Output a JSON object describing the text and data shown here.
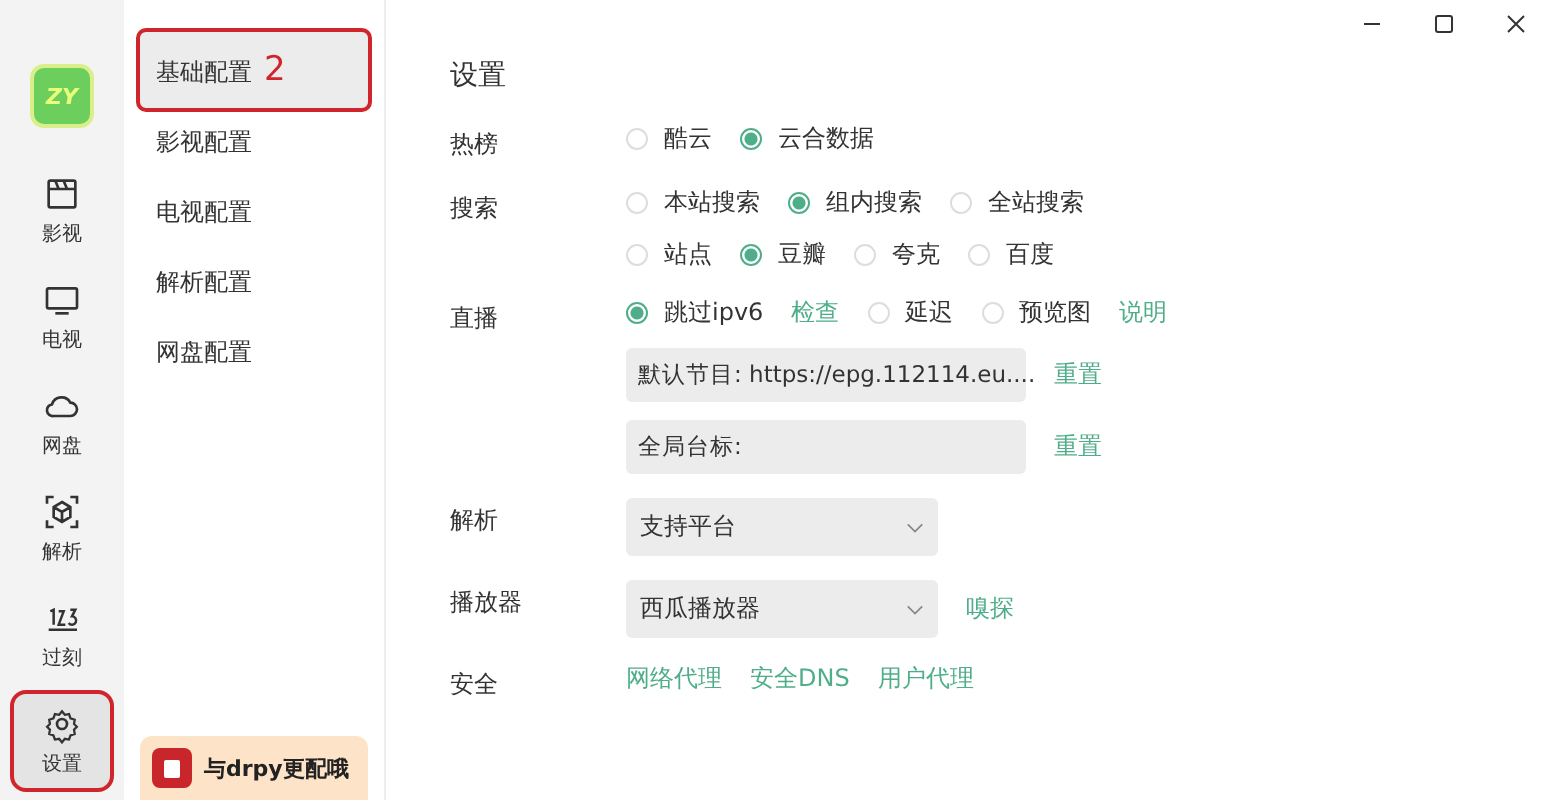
{
  "rail": [
    {
      "label": "影视",
      "kind": "film",
      "selected": false
    },
    {
      "label": "电视",
      "kind": "tv",
      "selected": false
    },
    {
      "label": "网盘",
      "kind": "cloud",
      "selected": false
    },
    {
      "label": "解析",
      "kind": "cube",
      "selected": false
    },
    {
      "label": "过刻",
      "kind": "numbers",
      "selected": false
    },
    {
      "label": "设置",
      "kind": "gear",
      "selected": true
    }
  ],
  "logo": "ZY",
  "submenu": [
    {
      "label": "基础配置",
      "selected": true
    },
    {
      "label": "影视配置",
      "selected": false
    },
    {
      "label": "电视配置",
      "selected": false
    },
    {
      "label": "解析配置",
      "selected": false
    },
    {
      "label": "网盘配置",
      "selected": false
    }
  ],
  "annotation_number": "2",
  "promo": "与drpy更配哦",
  "page_title": "设置",
  "sections": [
    {
      "label": "热榜",
      "kind": "radios",
      "lines": [
        [
          {
            "label": "酷云",
            "selected": false
          },
          {
            "label": "云合数据",
            "selected": true
          }
        ]
      ]
    },
    {
      "label": "搜索",
      "kind": "radios",
      "lines": [
        [
          {
            "label": "本站搜索",
            "selected": false
          },
          {
            "label": "组内搜索",
            "selected": true
          },
          {
            "label": "全站搜索",
            "selected": false
          }
        ],
        [
          {
            "label": "站点",
            "selected": false
          },
          {
            "label": "豆瓣",
            "selected": true
          },
          {
            "label": "夸克",
            "selected": false
          },
          {
            "label": "百度",
            "selected": false
          }
        ]
      ]
    },
    {
      "label": "直播",
      "kind": "live",
      "options": [
        {
          "label": "跳过ipv6",
          "selected": true,
          "link": "检查"
        },
        {
          "label": "延迟",
          "selected": false
        },
        {
          "label": "预览图",
          "selected": false,
          "link": "说明"
        }
      ],
      "fields": [
        {
          "value": "默认节目: https://epg.112114.eu....",
          "action": "重置"
        },
        {
          "value": "全局台标:",
          "action": "重置"
        }
      ]
    },
    {
      "label": "解析",
      "kind": "select",
      "value": "支持平台"
    },
    {
      "label": "播放器",
      "kind": "select",
      "value": "西瓜播放器",
      "link": "嗅探"
    },
    {
      "label": "安全",
      "kind": "links",
      "links": [
        "网络代理",
        "安全DNS",
        "用户代理"
      ]
    }
  ]
}
